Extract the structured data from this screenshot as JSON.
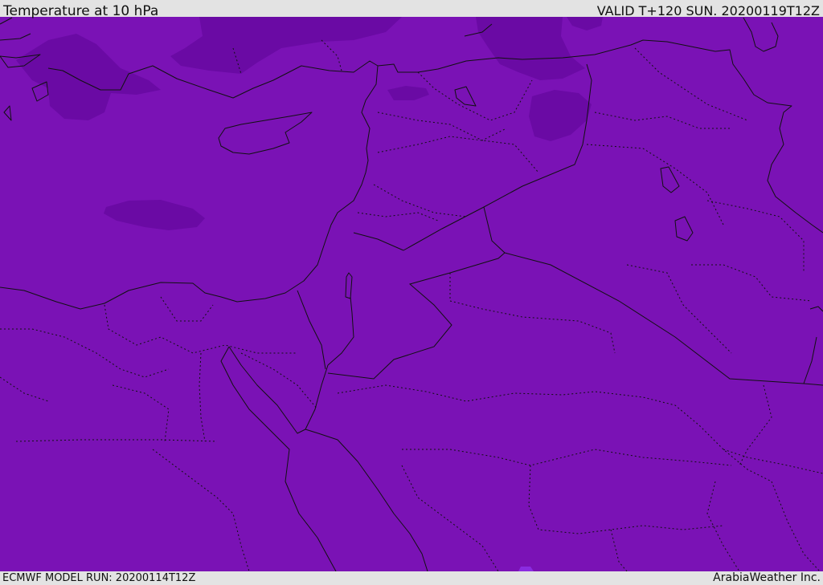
{
  "header": {
    "title": "Temperature at 10 hPa",
    "valid": "VALID T+120 SUN. 20200119T12Z"
  },
  "footer": {
    "model_run": "ECMWF MODEL RUN: 20200114T12Z",
    "brand": "ArabiaWeather Inc."
  },
  "map": {
    "field_color": "#7a12b5",
    "cold_region_color": "#6a0aa4",
    "border_color": "#111111"
  }
}
